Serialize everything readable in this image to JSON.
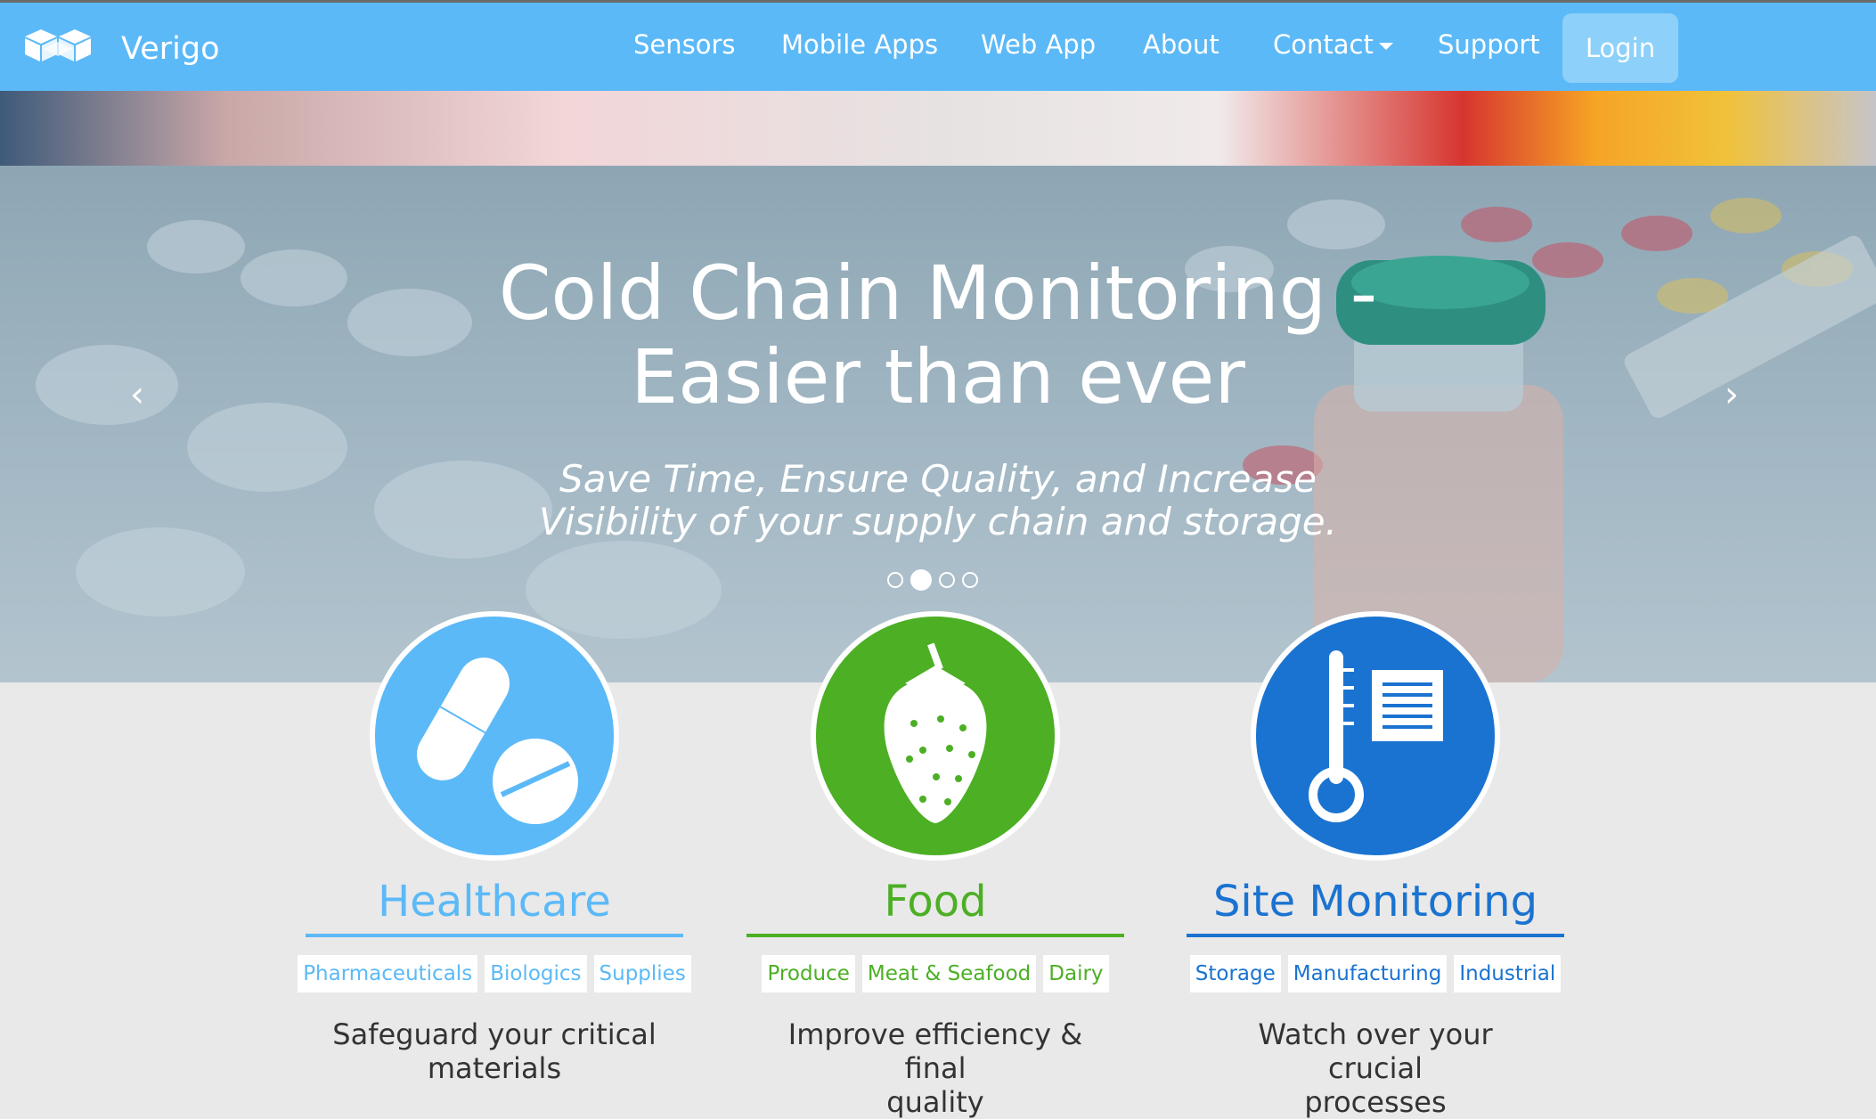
{
  "brand": {
    "name": "Verigo",
    "logo_icon": "cube-logo-icon"
  },
  "nav": {
    "items": [
      {
        "label": "Sensors"
      },
      {
        "label": "Mobile Apps"
      },
      {
        "label": "Web App"
      },
      {
        "label": "About"
      },
      {
        "label": "Contact"
      },
      {
        "label": "Support"
      }
    ],
    "login_label": "Login"
  },
  "hero": {
    "title_line1": "Cold Chain Monitoring -",
    "title_line2": "Easier than ever",
    "subtitle_line1": "Save Time, Ensure Quality, and Increase",
    "subtitle_line2": "Visibility of your supply chain and storage.",
    "prev_icon": "chevron-left-icon",
    "next_icon": "chevron-right-icon",
    "slide_count": 4,
    "active_slide": 2
  },
  "features": [
    {
      "title": "Healthcare",
      "icon": "pills-icon",
      "color": "#5cb9f7",
      "tags": [
        "Pharmaceuticals",
        "Biologics",
        "Supplies"
      ],
      "desc_line1": "Safeguard your critical",
      "desc_line2": "materials"
    },
    {
      "title": "Food",
      "icon": "strawberry-icon",
      "color": "#4caf24",
      "tags": [
        "Produce",
        "Meat & Seafood",
        "Dairy"
      ],
      "desc_line1": "Improve efficiency & final",
      "desc_line2": "quality"
    },
    {
      "title": "Site Monitoring",
      "icon": "thermometer-document-icon",
      "color": "#1a73d0",
      "tags": [
        "Storage",
        "Manufacturing",
        "Industrial"
      ],
      "desc_line1": "Watch over your crucial",
      "desc_line2": "processes"
    }
  ]
}
